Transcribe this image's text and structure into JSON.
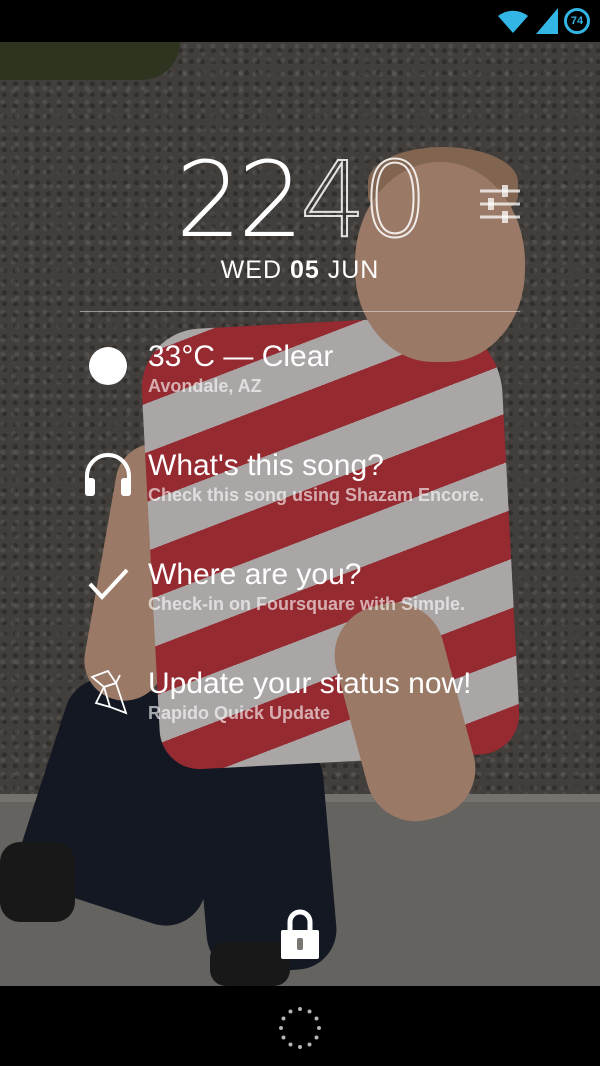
{
  "status_bar": {
    "battery_level": "74",
    "wifi_icon": "wifi-icon",
    "signal_icon": "cell-signal-icon"
  },
  "clock": {
    "hours": "22",
    "minutes": "40",
    "date_prefix": "WED",
    "date_day": "05",
    "date_suffix": "JUN"
  },
  "items": [
    {
      "icon": "sun-icon",
      "title": "33°C — Clear",
      "subtitle": "Avondale, AZ"
    },
    {
      "icon": "headphones-icon",
      "title": "What's this song?",
      "subtitle": "Check this song using Shazam Encore."
    },
    {
      "icon": "checkmark-icon",
      "title": "Where are you?",
      "subtitle": "Check-in on Foursquare with Simple."
    },
    {
      "icon": "origami-bird-icon",
      "title": "Update your status now!",
      "subtitle": "Rapido Quick Update"
    }
  ],
  "colors": {
    "accent": "#33b5e5",
    "text": "#ffffff"
  }
}
